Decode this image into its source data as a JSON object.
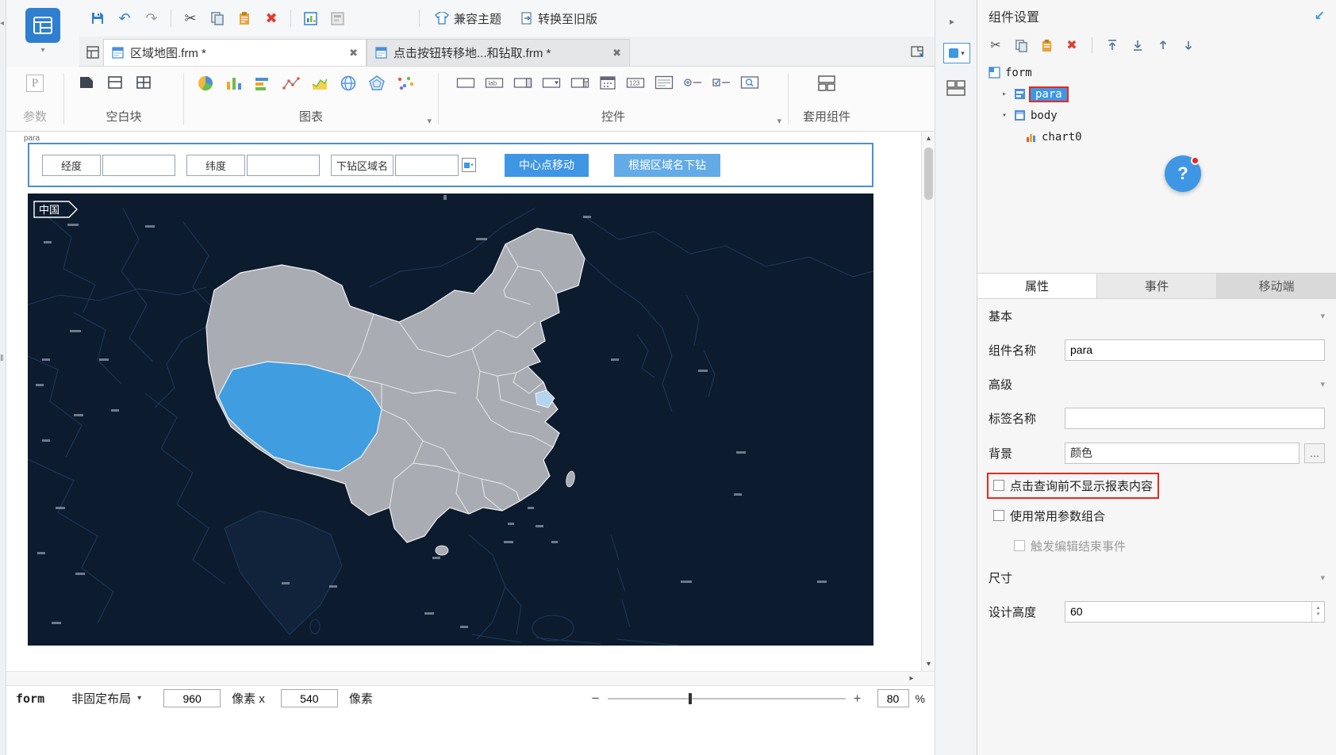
{
  "icons": {
    "chevron_down": "▾",
    "chevron_right": "▸",
    "chevron_up": "▴",
    "left_collapse": "◂",
    "splitter": "‖",
    "scissors": "✂",
    "delete_x": "✖",
    "undo": "↶",
    "redo": "↷",
    "arrow_up": "↑",
    "arrow_down": "↓",
    "question": "?",
    "ellipsis": "…",
    "corner_collapse": "↙",
    "minus": "−",
    "plus": "+"
  },
  "quick_toolbar": {
    "compat_theme": "兼容主题",
    "convert_old": "转换至旧版"
  },
  "tab_bar": {
    "tabs": [
      {
        "label": "区域地图.frm *"
      },
      {
        "label": "点击按钮转移地...和钻取.frm *"
      }
    ]
  },
  "ribbon": {
    "p_glyph": "P",
    "param_label": "参数",
    "blank_label": "空白块",
    "chart_label": "图表",
    "widget_label": "控件",
    "component_label": "套用组件",
    "lab_text": "lab",
    "num_text": "123"
  },
  "canvas": {
    "panel_tag": "para",
    "fields": [
      {
        "label": "经度"
      },
      {
        "label": "纬度"
      },
      {
        "label": "下钻区域名"
      }
    ],
    "buttons": [
      {
        "label": "中心点移动"
      },
      {
        "label": "根据区域名下钻"
      }
    ],
    "map_label": "中国"
  },
  "tree": {
    "items": [
      {
        "label": "form"
      },
      {
        "label": "para"
      },
      {
        "label": "body"
      },
      {
        "label": "chart0"
      }
    ]
  },
  "panel": {
    "title": "组件设置",
    "tabs": [
      {
        "label": "属性"
      },
      {
        "label": "事件"
      },
      {
        "label": "移动端"
      }
    ],
    "basic_section": "基本",
    "name_label": "组件名称",
    "name_value": "para",
    "advanced_section": "高级",
    "tag_label": "标签名称",
    "tag_value": "",
    "bg_label": "背景",
    "bg_value": "颜色",
    "cb_hide_report": "点击查询前不显示报表内容",
    "cb_common_params": "使用常用参数组合",
    "cb_trigger_end": "触发编辑结束事件",
    "size_section": "尺寸",
    "height_label": "设计高度",
    "height_value": "60"
  },
  "status": {
    "form": "form",
    "layout": "非固定布局",
    "width": "960",
    "wunit": "像素 x",
    "height": "540",
    "hunit": "像素",
    "zoom": "80",
    "zunit": "%"
  },
  "colors": {
    "accent": "#3f96e4",
    "map_bg": "#0d1b2e",
    "china_fill": "#a9adb3",
    "tibet_fill": "#3f9de0",
    "province_light": "#b5d4ee",
    "danger": "#e8281e"
  }
}
